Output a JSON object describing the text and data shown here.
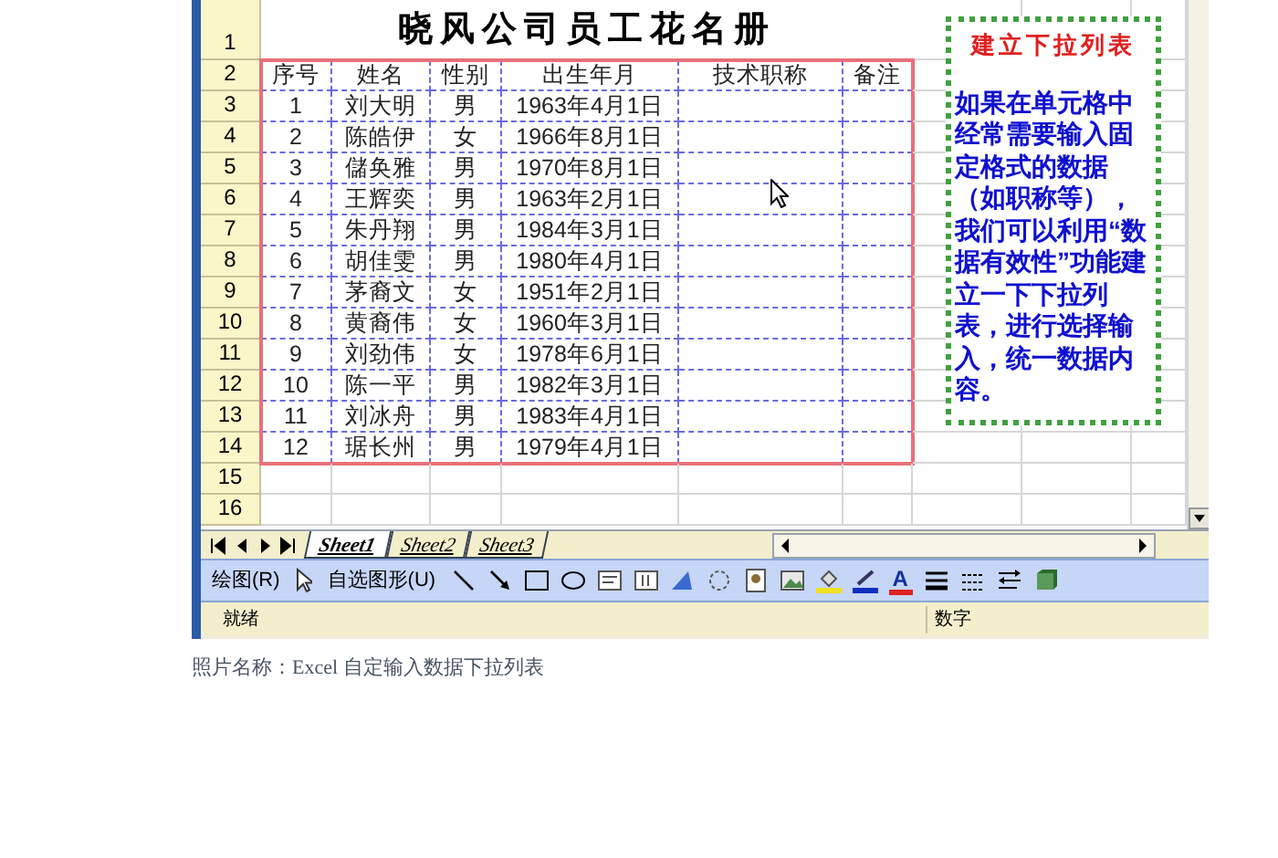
{
  "sheet": {
    "title": "晓风公司员工花名册",
    "row_numbers": [
      "1",
      "2",
      "3",
      "4",
      "5",
      "6",
      "7",
      "8",
      "9",
      "10",
      "11",
      "12",
      "13",
      "14",
      "15",
      "16"
    ],
    "headers": [
      "序号",
      "姓名",
      "性别",
      "出生年月",
      "技术职称",
      "备注"
    ],
    "rows": [
      {
        "no": "1",
        "name": "刘大明",
        "gender": "男",
        "birth": "1963年4月1日"
      },
      {
        "no": "2",
        "name": "陈皓伊",
        "gender": "女",
        "birth": "1966年8月1日"
      },
      {
        "no": "3",
        "name": "儲奂雅",
        "gender": "男",
        "birth": "1970年8月1日"
      },
      {
        "no": "4",
        "name": "王辉奕",
        "gender": "男",
        "birth": "1963年2月1日"
      },
      {
        "no": "5",
        "name": "朱丹翔",
        "gender": "男",
        "birth": "1984年3月1日"
      },
      {
        "no": "6",
        "name": "胡佳雯",
        "gender": "男",
        "birth": "1980年4月1日"
      },
      {
        "no": "7",
        "name": "茅裔文",
        "gender": "女",
        "birth": "1951年2月1日"
      },
      {
        "no": "8",
        "name": "黄裔伟",
        "gender": "女",
        "birth": "1960年3月1日"
      },
      {
        "no": "9",
        "name": "刘劲伟",
        "gender": "女",
        "birth": "1978年6月1日"
      },
      {
        "no": "10",
        "name": "陈一平",
        "gender": "男",
        "birth": "1982年3月1日"
      },
      {
        "no": "11",
        "name": "刘冰舟",
        "gender": "男",
        "birth": "1983年4月1日"
      },
      {
        "no": "12",
        "name": "琚长州",
        "gender": "男",
        "birth": "1979年4月1日"
      }
    ],
    "note": {
      "title": "建立下拉列表",
      "body": "如果在单元格中经常需要输入固定格式的数据（如职称等），我们可以利用“数据有效性”功能建立一下下拉列表，进行选择输入，统一数据内容。"
    }
  },
  "sheet_tabs": [
    {
      "label": "Sheet1",
      "selected": true
    },
    {
      "label": "Sheet2",
      "selected": false
    },
    {
      "label": "Sheet3",
      "selected": false
    }
  ],
  "drawing_toolbar": {
    "draw_menu": "绘图(R)",
    "autoshapes": "自选图形(U)",
    "font_color_glyph": "A"
  },
  "status_bar": {
    "status": "就绪",
    "mode": "数字"
  },
  "caption": "照片名称：Excel 自定输入数据下拉列表"
}
